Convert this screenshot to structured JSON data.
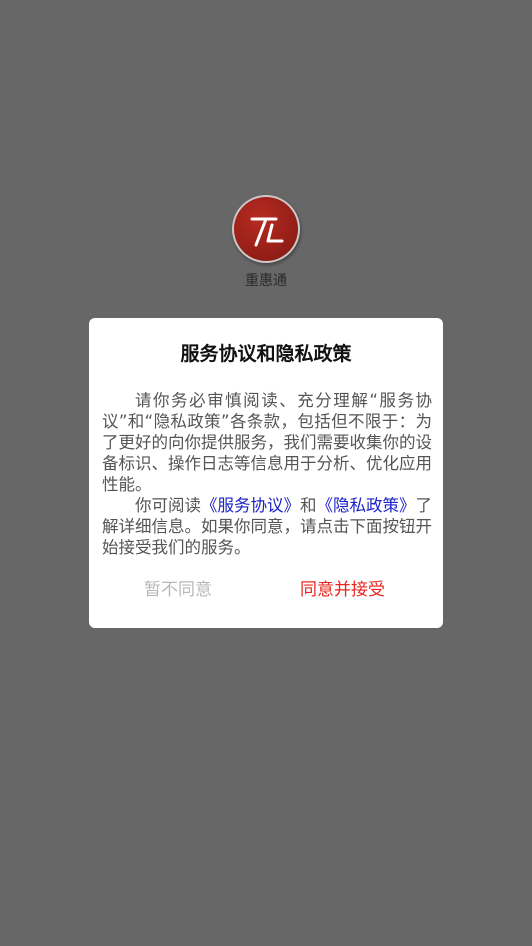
{
  "app": {
    "name": "重惠通"
  },
  "dialog": {
    "title": "服务协议和隐私政策",
    "paragraph1": "请你务必审慎阅读、充分理解“服务协议”和“隐私政策”各条款，包括但不限于：为了更好的向你提供服务，我们需要收集你的设备标识、操作日志等信息用于分析、优化应用性能。",
    "paragraph2": {
      "prefix": "你可阅读",
      "link_service": "《服务协议》",
      "middle": "和",
      "link_privacy": "《隐私政策》",
      "suffix": "了解详细信息。如果你同意，请点击下面按钮开始接受我们的服务。"
    },
    "decline_label": "暂不同意",
    "accept_label": "同意并接受"
  },
  "colors": {
    "overlay": "#676767",
    "link": "#1a22c9",
    "accept": "#e8241d",
    "decline": "#b8b8b8"
  }
}
